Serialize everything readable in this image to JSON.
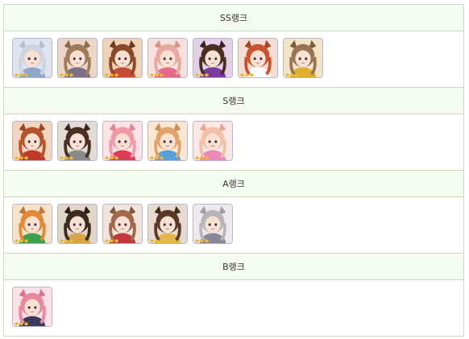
{
  "tiers": [
    {
      "title": "SS랭크",
      "characters": [
        {
          "icon": "character-portrait-icon",
          "hair": "#cfd3dc",
          "bg": "#dfe3f0",
          "accent": "#8fa7c9",
          "ears": "#b8bdc9"
        },
        {
          "icon": "character-portrait-icon",
          "hair": "#a17a5a",
          "bg": "#ead7c8",
          "accent": "#7c6f8a",
          "ears": "#8e6a4f"
        },
        {
          "icon": "character-portrait-icon",
          "hair": "#8a4a2a",
          "bg": "#f0d2b9",
          "accent": "#c74b35",
          "ears": "#6e3a22"
        },
        {
          "icon": "character-portrait-icon",
          "hair": "#e7a8a0",
          "bg": "#f7e1dc",
          "accent": "#e36a8a",
          "ears": "#d99489"
        },
        {
          "icon": "character-portrait-icon",
          "hair": "#4a2e22",
          "bg": "#e3d0e6",
          "accent": "#7a3aa0",
          "ears": "#3a241a"
        },
        {
          "icon": "character-portrait-icon",
          "hair": "#c9532f",
          "bg": "#f3ddd2",
          "accent": "#ffffff",
          "ears": "#a94526"
        },
        {
          "icon": "character-portrait-icon",
          "hair": "#9a7450",
          "bg": "#f1e4c8",
          "accent": "#e0b030",
          "ears": "#7e5d3f"
        }
      ]
    },
    {
      "title": "S랭크",
      "characters": [
        {
          "icon": "character-portrait-icon",
          "hair": "#b5552c",
          "bg": "#f2d5c0",
          "accent": "#c0392b",
          "ears": "#9a4523"
        },
        {
          "icon": "character-portrait-icon",
          "hair": "#4a3024",
          "bg": "#e4dbd5",
          "accent": "#8a8a8a",
          "ears": "#3a261c"
        },
        {
          "icon": "character-portrait-icon",
          "hair": "#ef9aa6",
          "bg": "#fbe2e6",
          "accent": "#e03c58",
          "ears": "#e38594"
        },
        {
          "icon": "character-portrait-icon",
          "hair": "#e2a36a",
          "bg": "#f8e7d3",
          "accent": "#5aa0d8",
          "ears": "#cf8d55"
        },
        {
          "icon": "character-portrait-icon",
          "hair": "#f2c0a8",
          "bg": "#fbe8e6",
          "accent": "#e889b9",
          "ears": "#e9a58d"
        }
      ]
    },
    {
      "title": "A랭크",
      "characters": [
        {
          "icon": "character-portrait-icon",
          "hair": "#e08a3a",
          "bg": "#f6e1c9",
          "accent": "#3aa04a",
          "ears": "#c77631"
        },
        {
          "icon": "character-portrait-icon",
          "hair": "#3a2a20",
          "bg": "#e0d6c8",
          "accent": "#d9a34a",
          "ears": "#2c1f18"
        },
        {
          "icon": "character-portrait-icon",
          "hair": "#a06a4a",
          "bg": "#f1e4dc",
          "accent": "#c0393b",
          "ears": "#84573c"
        },
        {
          "icon": "character-portrait-icon",
          "hair": "#5a3828",
          "bg": "#e6d9cf",
          "accent": "#e2b64a",
          "ears": "#472c1f"
        },
        {
          "icon": "character-portrait-icon",
          "hair": "#b9b4b8",
          "bg": "#eceaee",
          "accent": "#8a8699",
          "ears": "#a39ea2"
        }
      ]
    },
    {
      "title": "B랭크",
      "characters": [
        {
          "icon": "character-portrait-icon",
          "hair": "#e889a0",
          "bg": "#f9e1e7",
          "accent": "#3a3a5a",
          "ears": "#d97390"
        }
      ]
    }
  ]
}
